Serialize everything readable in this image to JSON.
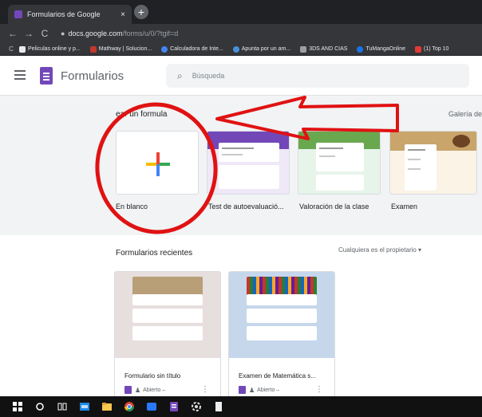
{
  "browser": {
    "tab_title": "Formularios de Google",
    "tab_close_glyph": "×",
    "new_tab_glyph": "+",
    "url_host": "docs.google.com",
    "url_path": "/forms/u/0/?tgif=d"
  },
  "bookmarks": [
    {
      "label": "Peliculas online y p...",
      "color": "#e8eaed"
    },
    {
      "label": "Mathway | Solucion...",
      "color": "#c0392b"
    },
    {
      "label": "Calculadora de Inte...",
      "color": "#4285f4"
    },
    {
      "label": "Apunta por un am...",
      "color": "#4a90d9"
    },
    {
      "label": "3DS AND CIAS",
      "color": "#5f6368"
    },
    {
      "label": "TuMangaOnline",
      "color": "#1a73e8"
    },
    {
      "label": "(1) Top 10",
      "color": "#e53935"
    }
  ],
  "header": {
    "app_title": "Formularios",
    "search_placeholder": "Búsqueda"
  },
  "gallery": {
    "heading": "ear un formula",
    "gallery_link": "Galería de",
    "templates": [
      {
        "label": "En blanco"
      },
      {
        "label": "Test de autoevaluació..."
      },
      {
        "label": "Valoración de la clase"
      },
      {
        "label": "Examen"
      }
    ]
  },
  "recent": {
    "title": "Formularios recientes",
    "owner_filter": "Cualquiera es el propietario ▾",
    "items": [
      {
        "name": "Formulario sin título",
        "meta": "Abierto –"
      },
      {
        "name": "Examen de Matemática s...",
        "meta": "Abierto –"
      }
    ]
  },
  "colors": {
    "forms_purple": "#7248b9",
    "annotation_red": "#e01212"
  },
  "icons": {
    "menu": "hamburger-icon",
    "search": "search-icon",
    "more": "more-vert-icon",
    "people": "people-icon"
  }
}
